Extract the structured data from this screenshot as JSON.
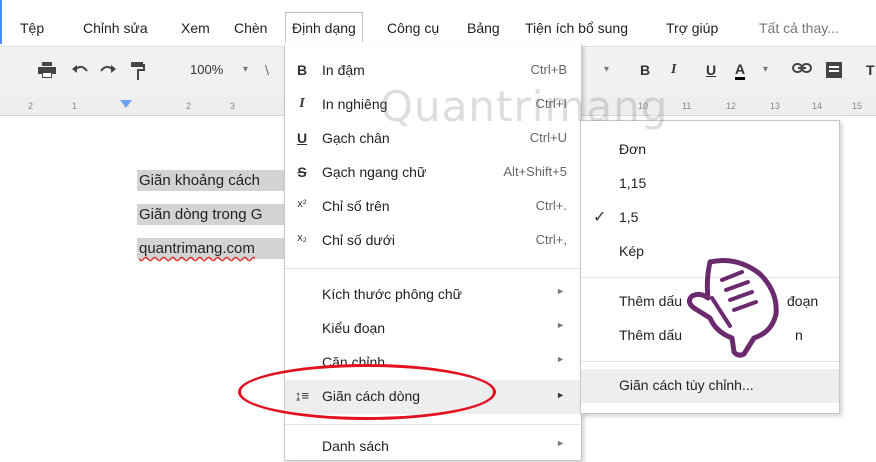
{
  "menubar": {
    "items": [
      "Tệp",
      "Chỉnh sửa",
      "Xem",
      "Chèn",
      "Định dạng",
      "Công cụ",
      "Bảng",
      "Tiện ích bổ sung",
      "Trợ giúp",
      "Tất cả thay..."
    ]
  },
  "toolbar": {
    "zoom": "100%",
    "zoom_caret": "▾",
    "left_fragment": "\\",
    "bold": "B",
    "italic": "I",
    "underline": "U",
    "text_color": "A"
  },
  "ruler": {
    "left_ticks": [
      "2",
      "1",
      "1",
      "2",
      "3"
    ],
    "right_ticks": [
      "10",
      "11",
      "12",
      "13",
      "14",
      "15"
    ]
  },
  "document": {
    "lines": [
      "Giãn khoảng cách",
      "Giãn dòng trong G",
      "quantrimang.com"
    ]
  },
  "format_menu": {
    "items": [
      {
        "icon": "B",
        "label": "In đậm",
        "shortcut": "Ctrl+B"
      },
      {
        "icon": "I",
        "label": "In nghiêng",
        "shortcut": "Ctrl+I"
      },
      {
        "icon": "U",
        "label": "Gạch chân",
        "shortcut": "Ctrl+U"
      },
      {
        "icon": "S",
        "label": "Gạch ngang chữ",
        "shortcut": "Alt+Shift+5"
      },
      {
        "icon": "x²",
        "label": "Chỉ số trên",
        "shortcut": "Ctrl+."
      },
      {
        "icon": "x₂",
        "label": "Chỉ số dưới",
        "shortcut": "Ctrl+,"
      }
    ],
    "sub_items": [
      {
        "label": "Kích thước phông chữ"
      },
      {
        "label": "Kiểu đoạn"
      },
      {
        "label": "Căn chỉnh"
      },
      {
        "label": "Giãn cách dòng"
      },
      {
        "label": "Danh sách"
      }
    ],
    "arrow": "►",
    "line_spacing_icon": "↨≡"
  },
  "line_spacing_submenu": {
    "items": [
      "Đơn",
      "1,15",
      "1,5",
      "Kép"
    ],
    "checked": "1,5",
    "check_mark": "✓",
    "add_items": [
      "Thêm dấu cách trước đoạn",
      "Thêm dấu cách sau đoạn"
    ],
    "add_items_visible": [
      "Thêm dấu",
      "đoạn",
      "Thêm dấu",
      "n"
    ],
    "custom": "Giãn cách tùy chỉnh..."
  },
  "watermark": "Quantrimang",
  "colors": {
    "highlight_ellipse": "#e3101f",
    "pointer_hand": "#6b2a6e",
    "doc_highlight": "#d3d3d3",
    "accent": "#4a8af4"
  }
}
